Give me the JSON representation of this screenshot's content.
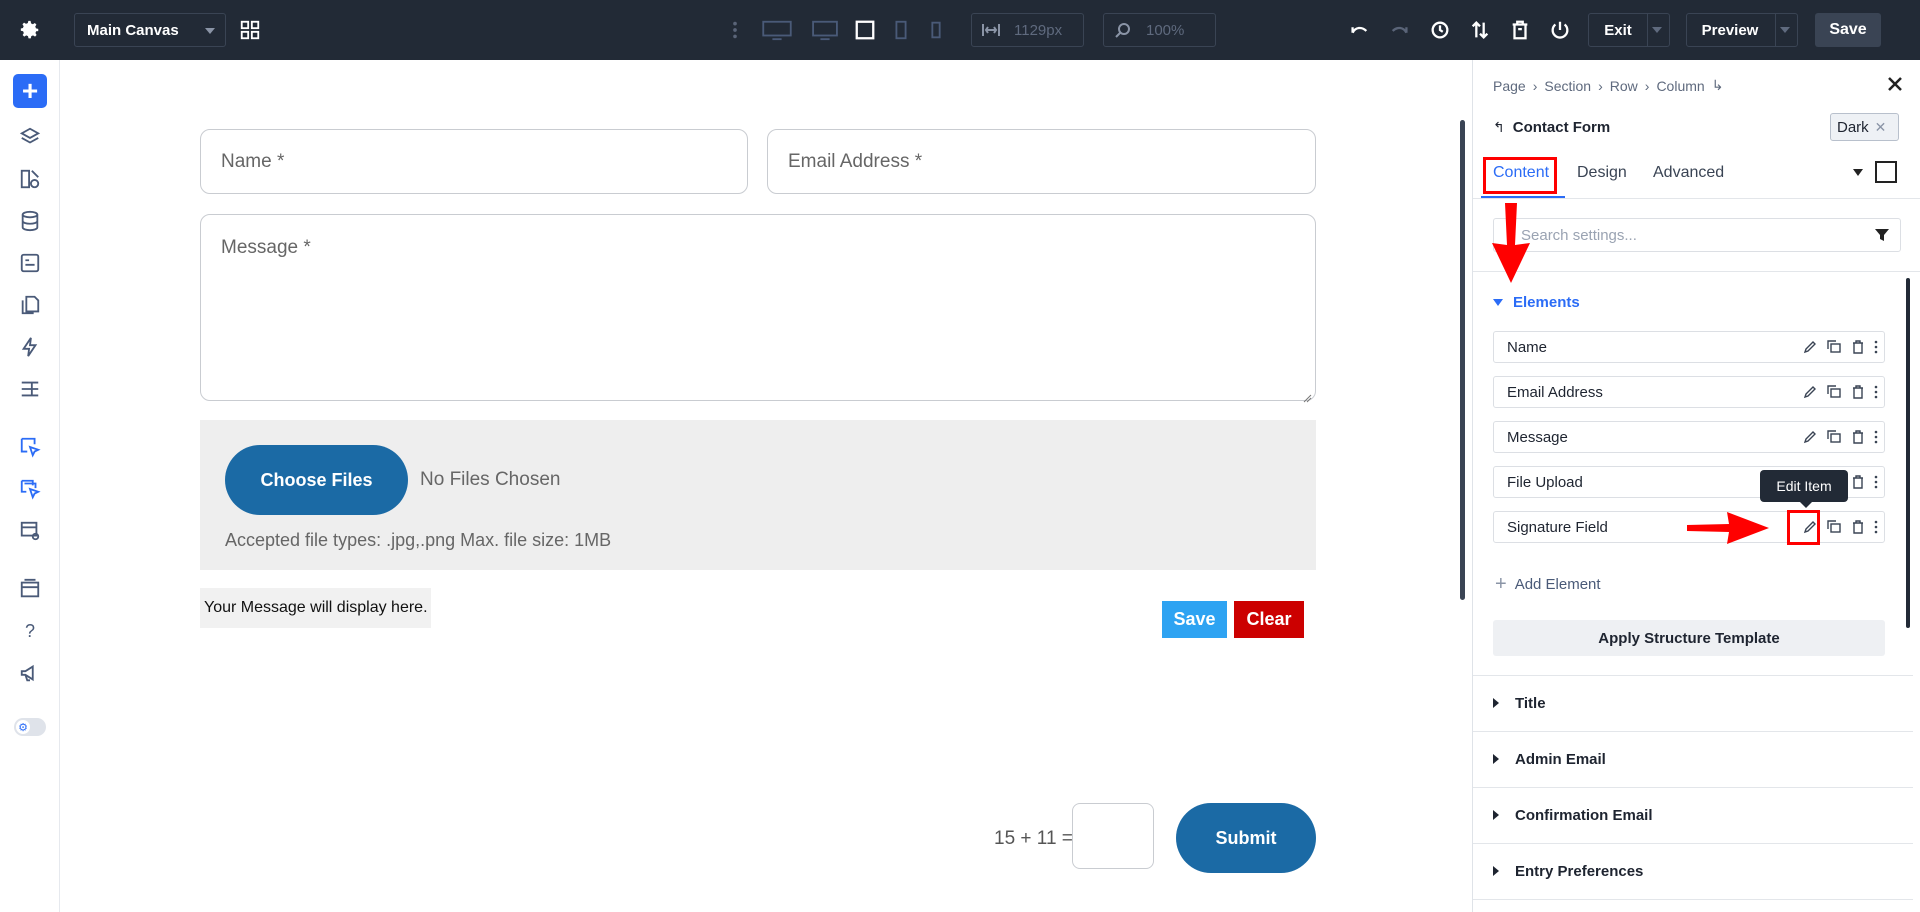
{
  "topbar": {
    "canvas_select": "Main Canvas",
    "width_value": "1129px",
    "zoom_value": "100%",
    "exit_label": "Exit",
    "preview_label": "Preview",
    "save_label": "Save"
  },
  "canvas": {
    "name_placeholder": "Name *",
    "email_placeholder": "Email Address *",
    "message_placeholder": "Message *",
    "choose_files_label": "Choose Files",
    "no_files_text": "No Files Chosen",
    "file_types_text": "Accepted file types: .jpg,.png Max. file size: 1MB",
    "signature_message": "Your Message will display here.",
    "sig_save_label": "Save",
    "sig_clear_label": "Clear",
    "captcha_text": "15 + 11 =",
    "submit_label": "Submit"
  },
  "panel": {
    "breadcrumb": [
      "Page",
      "Section",
      "Row",
      "Column"
    ],
    "module_title": "Contact Form",
    "preset_badge": "Dark",
    "tabs": [
      "Content",
      "Design",
      "Advanced"
    ],
    "active_tab": "Content",
    "search_placeholder": "Search settings...",
    "elements_heading": "Elements",
    "elements": [
      "Name",
      "Email Address",
      "Message",
      "File Upload",
      "Signature Field"
    ],
    "tooltip": "Edit Item",
    "add_element_label": "Add Element",
    "apply_template_label": "Apply Structure Template",
    "sections": [
      "Title",
      "Admin Email",
      "Confirmation Email",
      "Entry Preferences"
    ]
  },
  "colors": {
    "topbar_bg": "#222a36",
    "accent_blue": "#2b6cf6",
    "button_blue": "#1b6aa5",
    "sig_save": "#2ea3f2",
    "sig_clear": "#cc0000",
    "annotation_red": "#ff0000"
  }
}
